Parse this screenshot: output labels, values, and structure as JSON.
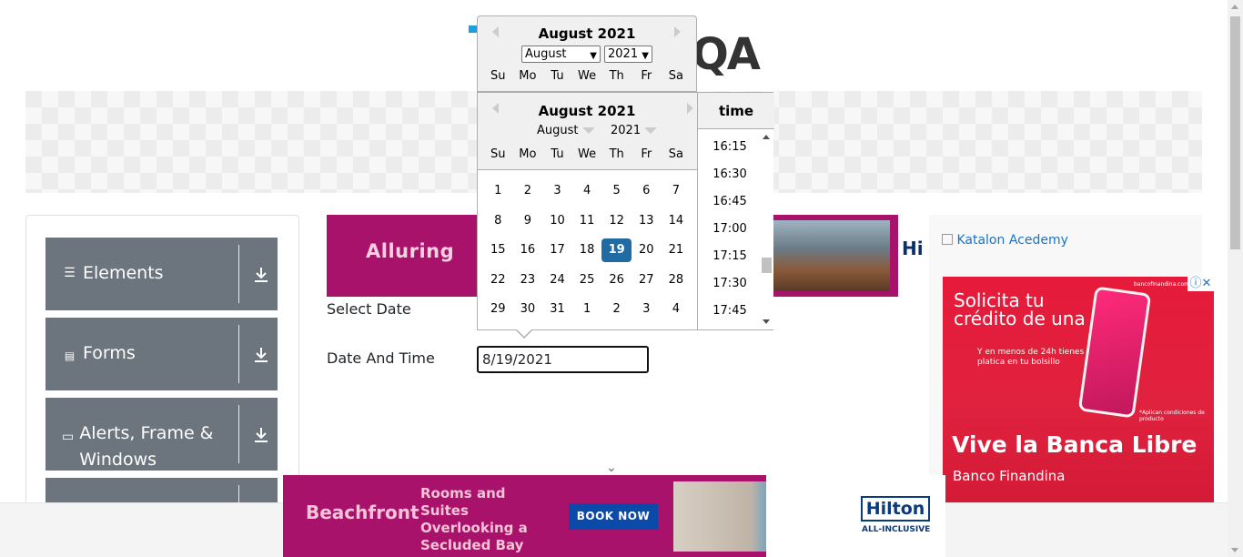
{
  "header": {
    "logo_text": "QA"
  },
  "sidebar": {
    "groups": [
      {
        "label": "Elements",
        "icon": "hamburger-icon"
      },
      {
        "label": "Forms",
        "icon": "document-icon"
      },
      {
        "label": "Alerts, Frame & Windows",
        "icon": "window-icon"
      }
    ]
  },
  "form": {
    "select_date_label": "Select Date",
    "date_time_label": "Date And Time",
    "date_time_value": "8/19/2021"
  },
  "datepicker_top": {
    "month_year": "August 2021",
    "month_select": "August",
    "year_select": "2021",
    "weekdays": [
      "Su",
      "Mo",
      "Tu",
      "We",
      "Th",
      "Fr",
      "Sa"
    ]
  },
  "datepicker": {
    "month_year": "August 2021",
    "month_dropdown": "August",
    "year_dropdown": "2021",
    "weekdays": [
      "Su",
      "Mo",
      "Tu",
      "We",
      "Th",
      "Fr",
      "Sa"
    ],
    "weeks": [
      [
        "1",
        "2",
        "3",
        "4",
        "5",
        "6",
        "7"
      ],
      [
        "8",
        "9",
        "10",
        "11",
        "12",
        "13",
        "14"
      ],
      [
        "15",
        "16",
        "17",
        "18",
        "19",
        "20",
        "21"
      ],
      [
        "22",
        "23",
        "24",
        "25",
        "26",
        "27",
        "28"
      ],
      [
        "29",
        "30",
        "31",
        "1",
        "2",
        "3",
        "4"
      ]
    ],
    "selected_day": "19",
    "time_header": "time",
    "times": [
      "16:15",
      "16:30",
      "16:45",
      "17:00",
      "17:15",
      "17:30",
      "17:45"
    ],
    "selected_color": "#216ba5"
  },
  "ads": {
    "top_text": "Alluring",
    "katalon": "Katalon Acedemy",
    "bank": {
      "headline": "Solicita tu crédito de una",
      "sub": "Y en menos de 24h tienes la platica en tu bolsillo",
      "tagline": "Vive la Banca Libre",
      "brand": "Banco Finandina",
      "url": "bancofinandina.com",
      "disclaimer": "*Aplican condiciones de producto"
    },
    "bottom": {
      "brand_word": "Beachfront",
      "rooms": "Rooms and Suites Overlooking a Secluded Bay",
      "cta": "BOOK NOW",
      "hilton": "Hilton",
      "hilton_sub": "ALL-INCLUSIVE"
    }
  }
}
